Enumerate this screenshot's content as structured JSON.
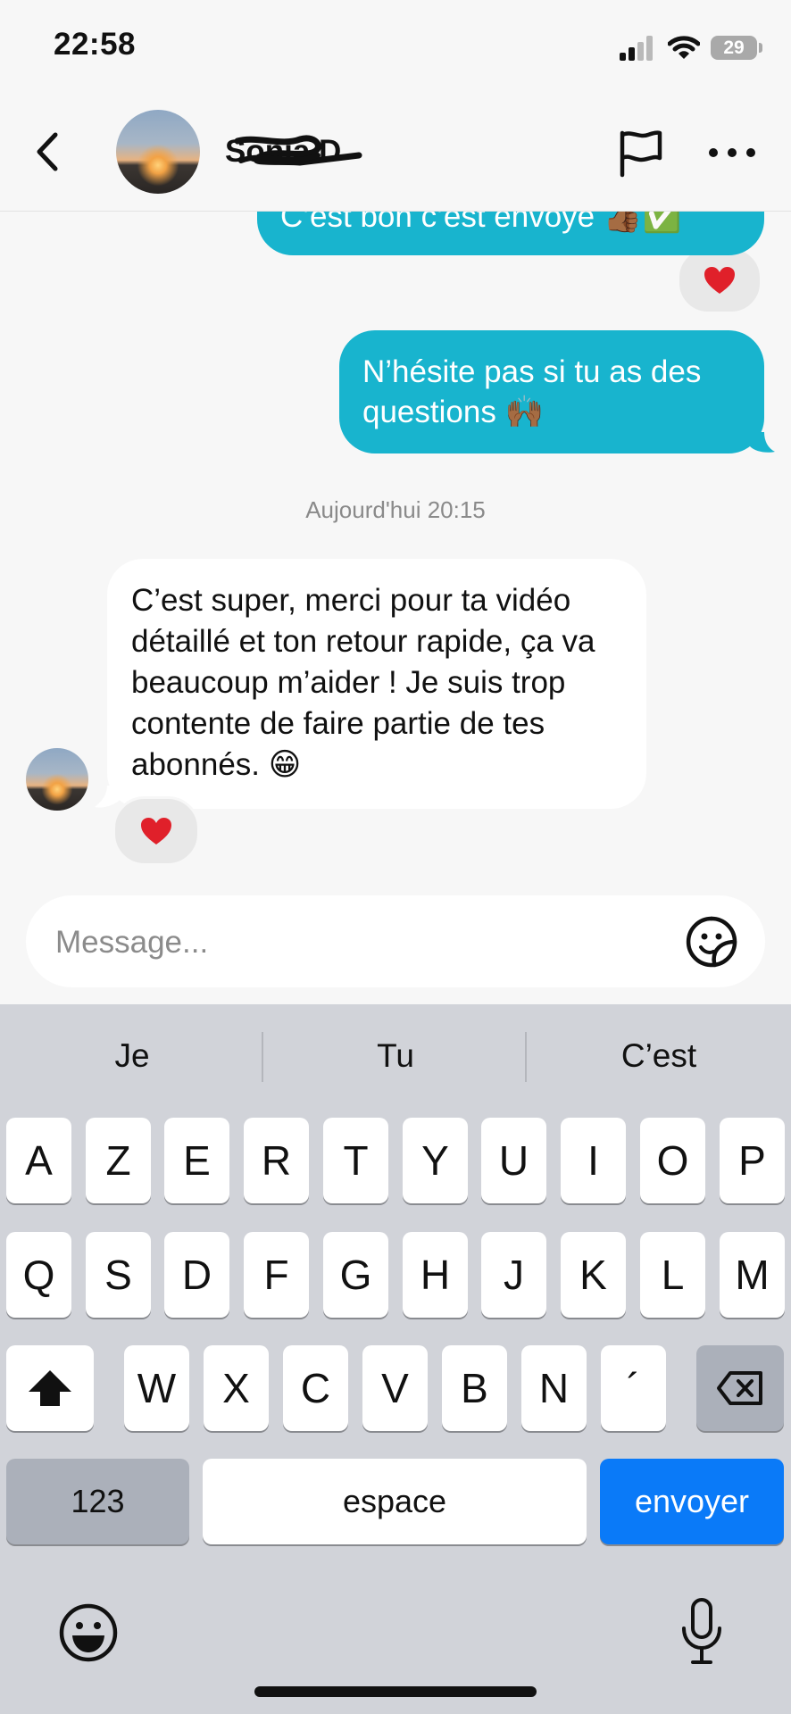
{
  "status_bar": {
    "time": "22:58",
    "battery": "29",
    "icons": [
      "signal-icon",
      "wifi-icon",
      "battery-icon"
    ]
  },
  "header": {
    "contact_name": "Sonia D",
    "icons": [
      "chevron-left-icon",
      "flag-icon",
      "more-horizontal-icon"
    ]
  },
  "messages": [
    {
      "direction": "outgoing",
      "text": "C’est bon c’est envoyé 👍🏾✅",
      "reaction": "❤️"
    },
    {
      "direction": "outgoing",
      "text": "N’hésite pas si tu as des questions 🙌🏾"
    },
    {
      "direction": "incoming",
      "text": "C’est super, merci pour ta vidéo détaillé et ton retour rapide, ça va beaucoup m’aider ! Je suis trop contente de faire partie de tes abonnés. 😁",
      "reaction": "❤️"
    }
  ],
  "date_separator": "Aujourd'hui 20:15",
  "composer": {
    "placeholder": "Message...",
    "icon": "sticker-icon"
  },
  "keyboard": {
    "suggestions": [
      "Je",
      "Tu",
      "C’est"
    ],
    "row1": [
      "A",
      "Z",
      "E",
      "R",
      "T",
      "Y",
      "U",
      "I",
      "O",
      "P"
    ],
    "row2": [
      "Q",
      "S",
      "D",
      "F",
      "G",
      "H",
      "J",
      "K",
      "L",
      "M"
    ],
    "row3": [
      "W",
      "X",
      "C",
      "V",
      "B",
      "N",
      "´"
    ],
    "numbers_key": "123",
    "space_key": "espace",
    "send_key": "envoyer",
    "icons": [
      "shift-icon",
      "backspace-icon",
      "emoji-icon",
      "microphone-icon"
    ]
  },
  "colors": {
    "outgoing_bubble": "#18b4ce",
    "incoming_bubble": "#ffffff",
    "send_key": "#0a7af8",
    "keyboard_bg": "#d1d3d9"
  }
}
